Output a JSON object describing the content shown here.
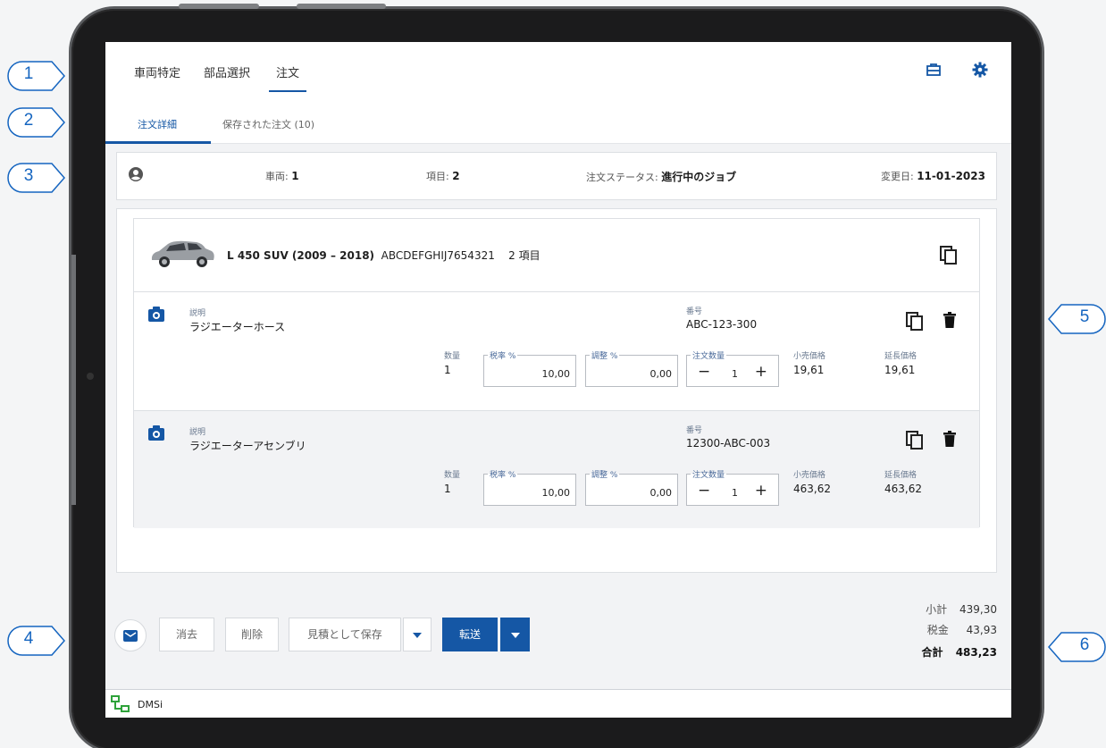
{
  "callouts": [
    "1",
    "2",
    "3",
    "4",
    "5",
    "6"
  ],
  "nav": {
    "tabs": [
      "車両特定",
      "部品選択",
      "注文"
    ],
    "active_tab": "注文",
    "icons": [
      "toolbox-icon",
      "gear-icon"
    ]
  },
  "subtabs": {
    "order_detail": "注文詳細",
    "saved_orders": "保存された注文 (10)"
  },
  "summary": {
    "vehicles_label": "車両: ",
    "vehicles_value": "1",
    "items_label": "項目: ",
    "items_value": "2",
    "status_label": "注文ステータス: ",
    "status_value": "進行中のジョブ",
    "modified_label": "変更日: ",
    "modified_value": "11-01-2023"
  },
  "vehicle": {
    "model": "L 450 SUV (2009 – 2018)",
    "vin": "ABCDEFGHIJ7654321",
    "item_count": "2 項目"
  },
  "labels": {
    "description": "説明",
    "number": "番号",
    "quantity": "数量",
    "tax_rate": "税率 %",
    "adjustment": "調整 %",
    "order_qty": "注文数量",
    "retail_price": "小売価格",
    "extended_price": "延長価格"
  },
  "lines": [
    {
      "description": "ラジエーターホース",
      "number": "ABC-123-300",
      "quantity": "1",
      "tax_rate": "10,00",
      "adjustment": "0,00",
      "order_qty": "1",
      "retail_price": "19,61",
      "extended_price": "19,61"
    },
    {
      "description": "ラジエーターアセンブリ",
      "number": "12300-ABC-003",
      "quantity": "1",
      "tax_rate": "10,00",
      "adjustment": "0,00",
      "order_qty": "1",
      "retail_price": "463,62",
      "extended_price": "463,62"
    }
  ],
  "footer": {
    "clear": "消去",
    "delete": "削除",
    "save_quote": "見積として保存",
    "transfer": "転送"
  },
  "totals": {
    "subtotal_label": "小計",
    "subtotal": "439,30",
    "tax_label": "税金",
    "tax": "43,93",
    "total_label": "合計",
    "total": "483,23"
  },
  "status_bar": {
    "label": "DMSi"
  },
  "colors": {
    "accent": "#1557a5",
    "callout": "#1565c0"
  }
}
